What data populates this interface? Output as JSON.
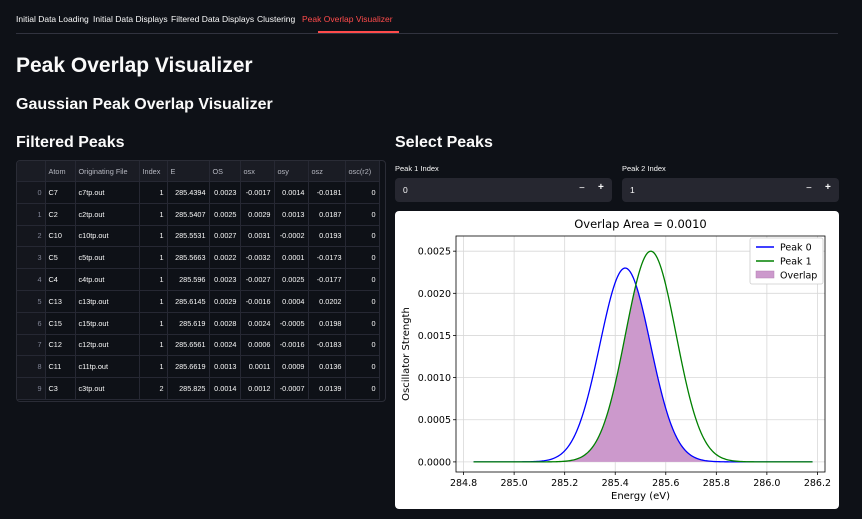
{
  "tabs": [
    {
      "label": "Initial Data Loading",
      "active": false
    },
    {
      "label": "Initial Data Displays",
      "active": false
    },
    {
      "label": "Filtered Data Displays",
      "active": false
    },
    {
      "label": "Clustering",
      "active": false
    },
    {
      "label": "Peak Overlap Visualizer",
      "active": true
    }
  ],
  "page_title": "Peak Overlap Visualizer",
  "link_icon": "link-icon",
  "subtitle": "Gaussian Peak Overlap Visualizer",
  "filtered_peaks": {
    "heading": "Filtered Peaks",
    "columns": [
      "",
      "Atom",
      "Originating File",
      "Index",
      "E",
      "OS",
      "osx",
      "osy",
      "osz",
      "osc(r2)"
    ],
    "rows": [
      [
        "0",
        "C7",
        "c7tp.out",
        "1",
        "285.4394",
        "0.0023",
        "-0.0017",
        "0.0014",
        "-0.0181",
        "0"
      ],
      [
        "1",
        "C2",
        "c2tp.out",
        "1",
        "285.5407",
        "0.0025",
        "0.0029",
        "0.0013",
        "0.0187",
        "0"
      ],
      [
        "2",
        "C10",
        "c10tp.out",
        "1",
        "285.5531",
        "0.0027",
        "0.0031",
        "-0.0002",
        "0.0193",
        "0"
      ],
      [
        "3",
        "C5",
        "c5tp.out",
        "1",
        "285.5663",
        "0.0022",
        "-0.0032",
        "0.0001",
        "-0.0173",
        "0"
      ],
      [
        "4",
        "C4",
        "c4tp.out",
        "1",
        "285.596",
        "0.0023",
        "-0.0027",
        "0.0025",
        "-0.0177",
        "0"
      ],
      [
        "5",
        "C13",
        "c13tp.out",
        "1",
        "285.6145",
        "0.0029",
        "-0.0016",
        "0.0004",
        "0.0202",
        "0"
      ],
      [
        "6",
        "C15",
        "c15tp.out",
        "1",
        "285.619",
        "0.0028",
        "0.0024",
        "-0.0005",
        "0.0198",
        "0"
      ],
      [
        "7",
        "C12",
        "c12tp.out",
        "1",
        "285.6561",
        "0.0024",
        "0.0006",
        "-0.0016",
        "-0.0183",
        "0"
      ],
      [
        "8",
        "C11",
        "c11tp.out",
        "1",
        "285.6619",
        "0.0013",
        "0.0011",
        "0.0009",
        "0.0136",
        "0"
      ],
      [
        "9",
        "C3",
        "c3tp.out",
        "2",
        "285.825",
        "0.0014",
        "0.0012",
        "-0.0007",
        "0.0139",
        "0"
      ]
    ]
  },
  "select_peaks": {
    "heading": "Select Peaks",
    "peak1": {
      "label": "Peak 1 Index",
      "value": "0",
      "minus": "−",
      "plus": "+"
    },
    "peak2": {
      "label": "Peak 2 Index",
      "value": "1",
      "minus": "−",
      "plus": "+"
    }
  },
  "chart_data": {
    "type": "line",
    "title": "Overlap Area = 0.0010",
    "xlabel": "Energy (eV)",
    "ylabel": "Oscillator Strength",
    "xlim": [
      284.8,
      286.2
    ],
    "ylim": [
      0,
      0.0025
    ],
    "xticks": [
      "284.8",
      "285.0",
      "285.2",
      "285.4",
      "285.6",
      "285.8",
      "286.0",
      "286.2"
    ],
    "yticks": [
      "0.0000",
      "0.0005",
      "0.0010",
      "0.0015",
      "0.0020",
      "0.0025"
    ],
    "grid": true,
    "legend_position": "top-right",
    "x_range": [
      284.8394,
      286.1807
    ],
    "series": [
      {
        "name": "Peak 0",
        "center": 285.4394,
        "amplitude": 0.0023,
        "sigma": 0.1,
        "color": "#0000ff"
      },
      {
        "name": "Peak 1",
        "center": 285.5407,
        "amplitude": 0.0025,
        "sigma": 0.1,
        "color": "#008000"
      }
    ],
    "overlap": {
      "name": "Overlap",
      "color": "#cc99cc"
    }
  }
}
